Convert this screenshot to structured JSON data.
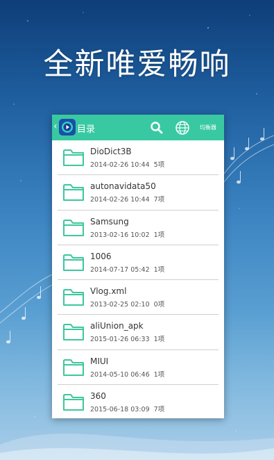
{
  "headline": "全新唯爱畅响",
  "toolbar": {
    "back_icon": "chevron-left-icon",
    "app_icon": "app-logo-icon",
    "title": "目录",
    "search_icon": "search-icon",
    "globe_icon": "globe-icon",
    "control_label": "均衡器"
  },
  "colors": {
    "accent": "#39c9a2",
    "folder": "#3cc79c"
  },
  "folders": [
    {
      "name": "DioDict3B",
      "date": "2014-02-26 10:44",
      "count": "5项"
    },
    {
      "name": "autonavidata50",
      "date": "2014-02-26 10:44",
      "count": "7项"
    },
    {
      "name": "Samsung",
      "date": "2013-02-16 10:02",
      "count": "1项"
    },
    {
      "name": "1006",
      "date": "2014-07-17 05:42",
      "count": "1项"
    },
    {
      "name": "Vlog.xml",
      "date": "2013-02-25 02:10",
      "count": "0项"
    },
    {
      "name": "aliUnion_apk",
      "date": "2015-01-26 06:33",
      "count": "1项"
    },
    {
      "name": "MIUI",
      "date": "2014-05-10 06:46",
      "count": "1项"
    },
    {
      "name": "360",
      "date": "2015-06-18 03:09",
      "count": "7项"
    }
  ]
}
